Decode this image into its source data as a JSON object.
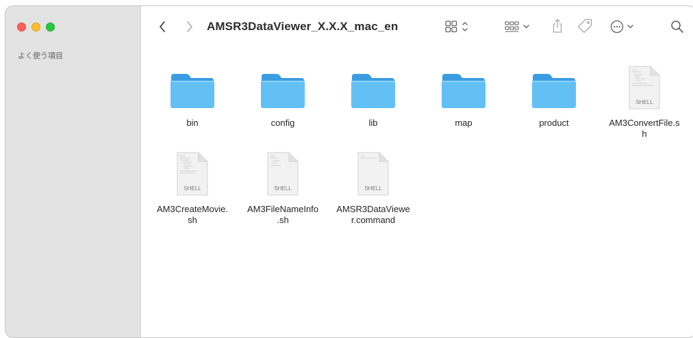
{
  "window": {
    "title": "AMSR3DataViewer_X.X.X_mac_en"
  },
  "sidebar": {
    "favorites_heading": "よく使う項目"
  },
  "toolbar": {
    "back_icon": "chevron-left-icon",
    "forward_icon": "chevron-right-icon",
    "view_icon": "grid-view-icon",
    "group_icon": "group-by-icon",
    "share_icon": "share-icon",
    "tag_icon": "tag-icon",
    "more_icon": "ellipsis-circle-icon",
    "search_icon": "search-icon"
  },
  "items": [
    {
      "name": "bin",
      "kind": "folder"
    },
    {
      "name": "config",
      "kind": "folder"
    },
    {
      "name": "lib",
      "kind": "folder"
    },
    {
      "name": "map",
      "kind": "folder"
    },
    {
      "name": "product",
      "kind": "folder"
    },
    {
      "name": "AM3ConvertFile.s\nh",
      "kind": "shell",
      "badge": "SHELL"
    },
    {
      "name": "AM3CreateMovie.\nsh",
      "kind": "shell",
      "badge": "SHELL"
    },
    {
      "name": "AM3FileNameInfo\n.sh",
      "kind": "shell",
      "badge": "SHELL"
    },
    {
      "name": "AMSR3DataViewe\nr.command",
      "kind": "shell",
      "badge": "SHELL"
    }
  ],
  "colors": {
    "folder_body": "#62c0f5",
    "folder_tab": "#3a9de2",
    "sidebar_bg": "#e3e3e3"
  }
}
